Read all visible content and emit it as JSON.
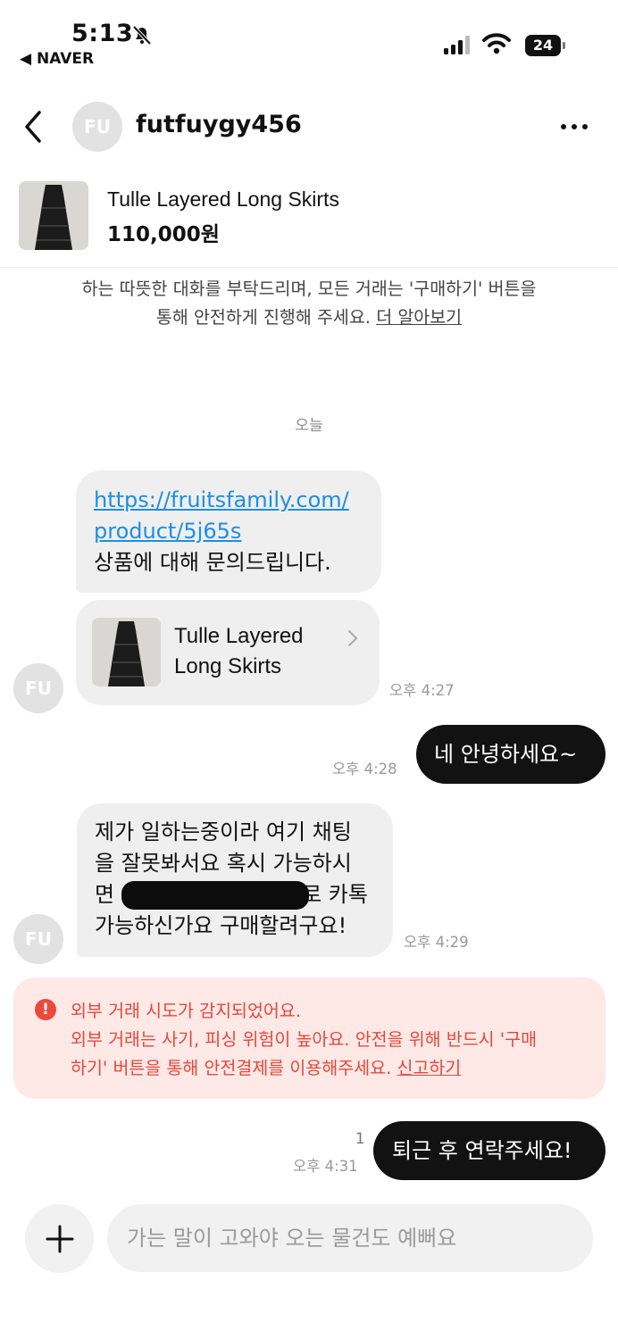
{
  "status_bar": {
    "time": "5:13",
    "back_app": "◀ NAVER",
    "battery": "24"
  },
  "header": {
    "avatar_initials": "FU",
    "username": "futfuygy456"
  },
  "product": {
    "title": "Tulle Layered Long Skirts",
    "price": "110,000원"
  },
  "notice": {
    "line1": "하는 따뜻한 대화를 부탁드리며, 모든 거래는 '구매하기' 버튼을",
    "line2": "통해 안전하게 진행해 주세요.",
    "link": "더 알아보기"
  },
  "date_separator": "오늘",
  "messages": [
    {
      "url_line1": "https://fruitsfamily.com/",
      "url_line2": "product/5j65s",
      "text": "상품에 대해 문의드립니다."
    },
    {
      "card_line1": "Tulle Layered",
      "card_line2": "Long Skirts",
      "time": "오후 4:27"
    },
    {
      "text": "네 안녕하세요~",
      "time": "오후 4:28"
    },
    {
      "line1": "제가 일하는중이라 여기 채팅",
      "line2": "을 잘못봐서요 혹시 가능하시",
      "line3_start": "면",
      "line3_end": "로 카톡",
      "line4": "가능하신가요 구매할려구요!",
      "time": "오후 4:29"
    },
    {
      "text": "퇴근 후 연락주세요!",
      "unread": "1",
      "time": "오후 4:31"
    }
  ],
  "alert": {
    "icon": "!",
    "line1": "외부 거래 시도가 감지되었어요.",
    "line2": "외부 거래는 사기, 피싱 위험이 높아요. 안전을 위해 반드시 '구매",
    "line3": "하기' 버튼을 통해 안전결제를 이용해주세요.",
    "link": "신고하기"
  },
  "composer": {
    "placeholder": "가는 말이 고와야 오는 물건도 예뻐요"
  },
  "colors": {
    "alert_text": "#e5483b",
    "alert_bg": "#fee9e7",
    "link": "#1d8ee4",
    "outgoing_bubble": "#121212",
    "incoming_bubble": "#efefef"
  }
}
